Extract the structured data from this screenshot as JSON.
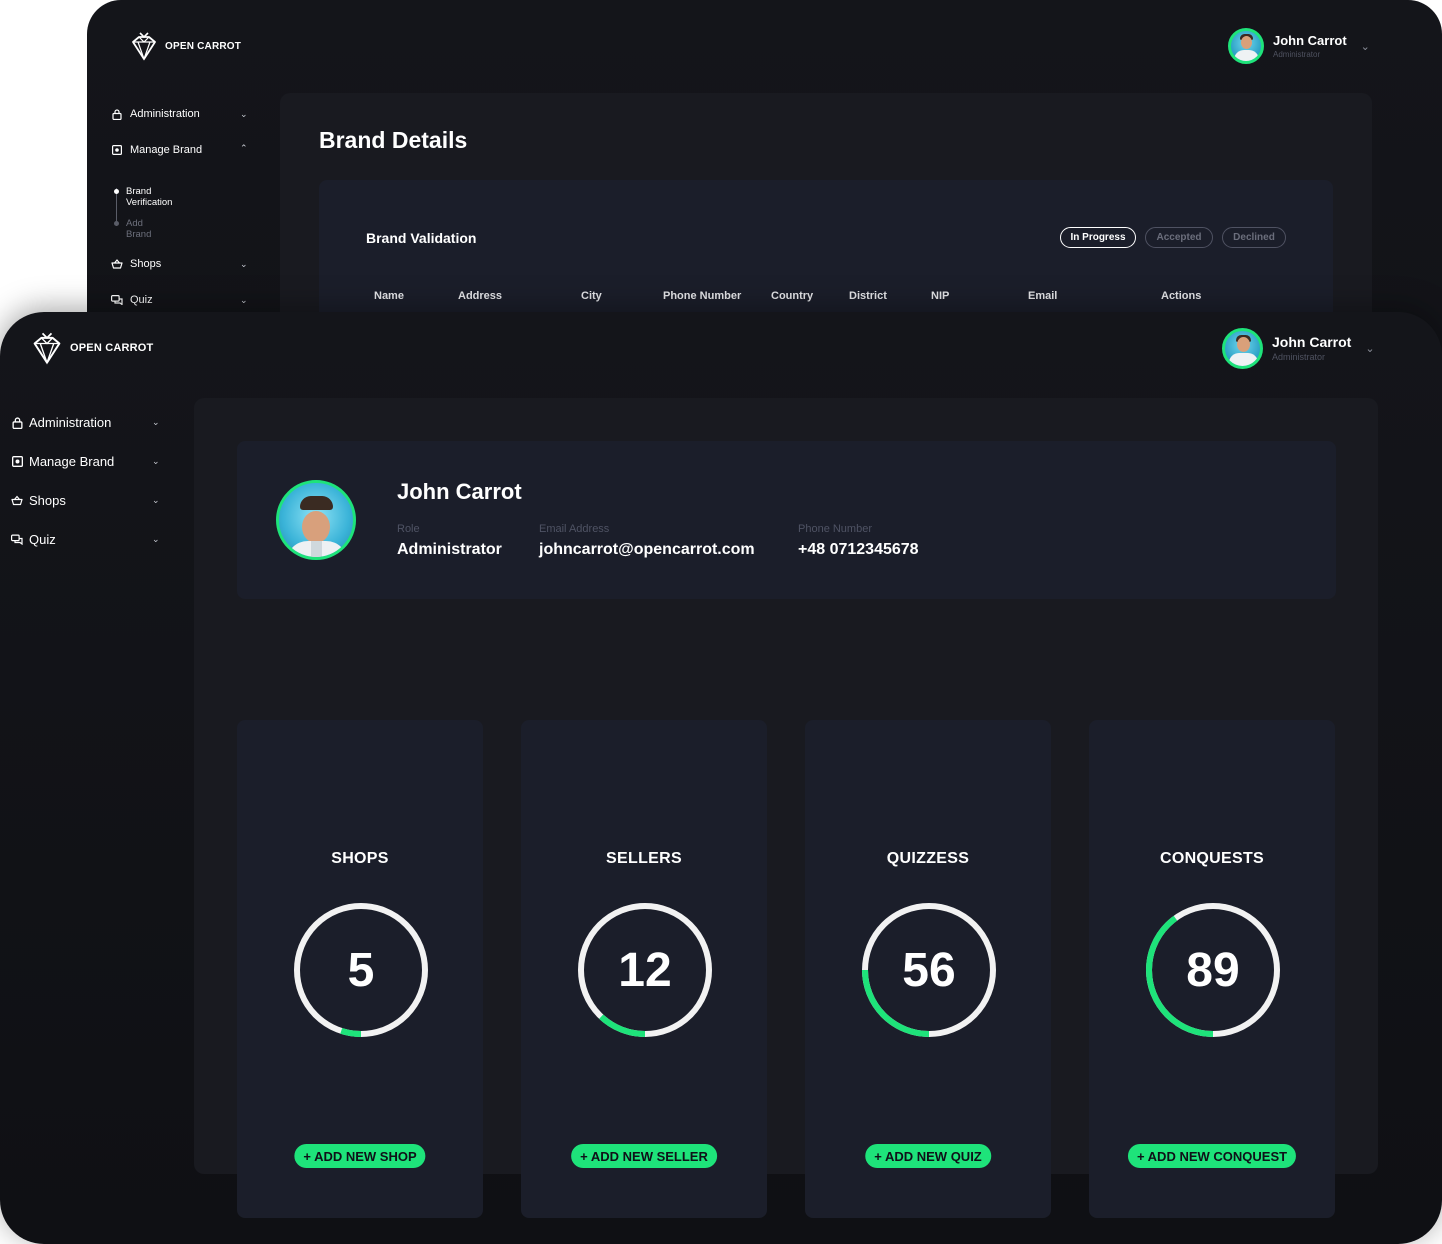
{
  "brand": {
    "name": "OPEN CARROT"
  },
  "user": {
    "name": "John Carrot",
    "role": "Administrator"
  },
  "back_window": {
    "sidebar": {
      "items": [
        {
          "label": "Administration"
        },
        {
          "label": "Manage Brand"
        },
        {
          "label": "Shops"
        },
        {
          "label": "Quiz"
        }
      ],
      "subitems": [
        {
          "label": "Brand Verification"
        },
        {
          "label": "Add Brand"
        }
      ]
    },
    "page_title": "Brand Details",
    "section_title": "Brand Validation",
    "filters": [
      "In Progress",
      "Accepted",
      "Declined"
    ],
    "table_headers": [
      "Name",
      "Address",
      "City",
      "Phone Number",
      "Country",
      "District",
      "NIP",
      "Email",
      "Actions"
    ]
  },
  "front_window": {
    "sidebar": {
      "items": [
        {
          "label": "Administration"
        },
        {
          "label": "Manage Brand"
        },
        {
          "label": "Shops"
        },
        {
          "label": "Quiz"
        }
      ]
    },
    "profile": {
      "name": "John Carrot",
      "role_label": "Role",
      "role": "Administrator",
      "email_label": "Email Address",
      "email": "johncarrot@opencarrot.com",
      "phone_label": "Phone Number",
      "phone": "+48 0712345678"
    },
    "stats": [
      {
        "title": "SHOPS",
        "value": "5",
        "progress": 0.05,
        "button": "+ ADD NEW SHOP"
      },
      {
        "title": "SELLERS",
        "value": "12",
        "progress": 0.12,
        "button": "+ ADD NEW SELLER"
      },
      {
        "title": "QUIZZESS",
        "value": "56",
        "progress": 0.25,
        "button": "+ ADD NEW QUIZ"
      },
      {
        "title": "CONQUESTS",
        "value": "89",
        "progress": 0.4,
        "button": "+ ADD NEW CONQUEST"
      }
    ]
  },
  "colors": {
    "accent": "#1ee37a",
    "panel": "#191a20",
    "card": "#1b1e2a",
    "ring": "#f2f2f2"
  },
  "icons": [
    "diamond-logo-icon",
    "lock-icon",
    "brand-icon",
    "basket-icon",
    "chat-icon",
    "chevron-down-icon",
    "chevron-up-icon"
  ]
}
